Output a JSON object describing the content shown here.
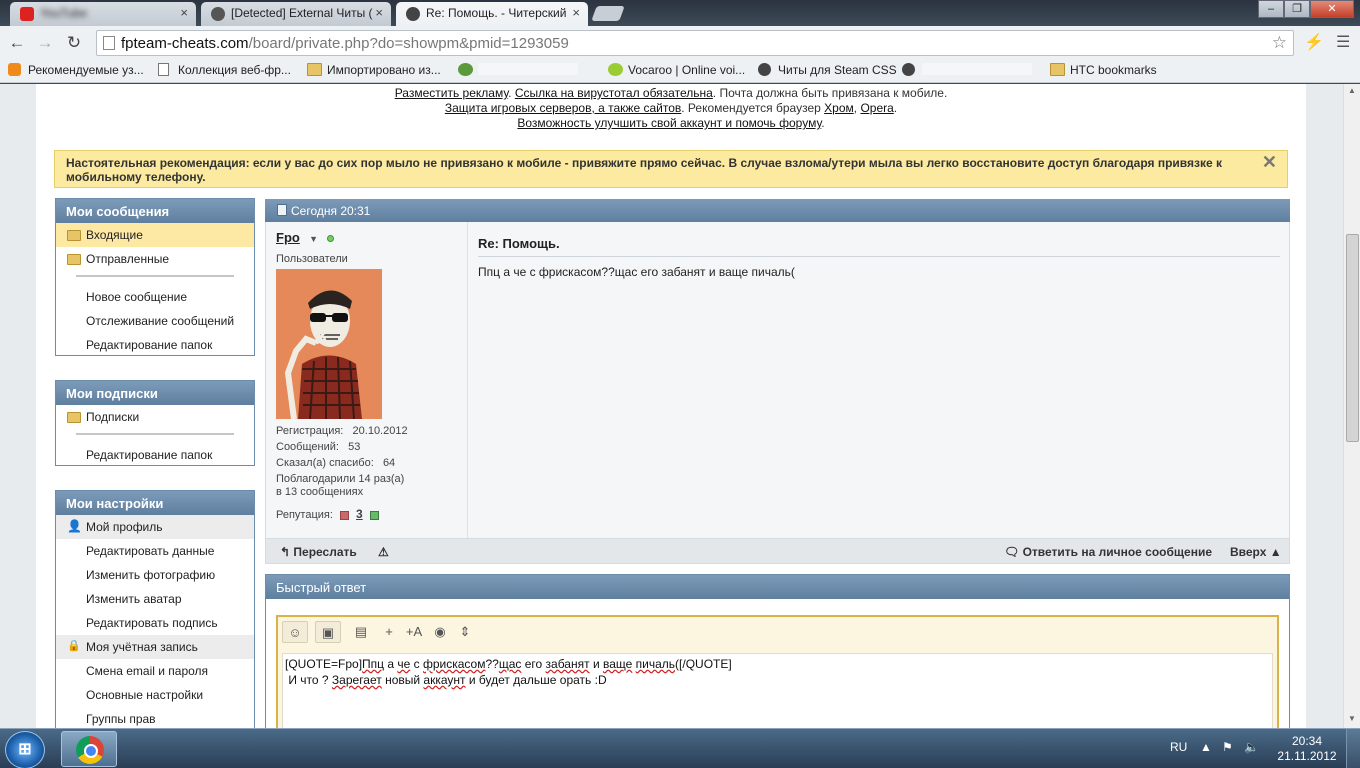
{
  "browser": {
    "tabs": [
      {
        "label": "YouTube",
        "close": "×"
      },
      {
        "label": "[Detected] External Читы (",
        "close": "×"
      },
      {
        "label": "Re: Помощь. - Читерский",
        "close": "×"
      }
    ],
    "url_host": "fpteam-cheats.com",
    "url_path": "/board/private.php?do=showpm&pmid=1293059",
    "bookmarks": [
      "Рекомендуемые уз...",
      "Коллекция веб-фр...",
      "Импортировано из...",
      "Vocaroo | Online voi...",
      "Читы для Steam CSS",
      "HTC bookmarks"
    ]
  },
  "notice": {
    "line1_link1": "Разместить рекламу",
    "line1_sep": ". ",
    "line1_link2": "Ссылка на вирустотал обязательна",
    "line1_text": ". Почта должна быть привязана к мобиле.",
    "line2_link": "Защита игровых серверов, а также сайтов",
    "line2_text": ". Рекомендуется браузер ",
    "line2_link2": "Хром",
    "line2_comma": ", ",
    "line2_link3": "Opera",
    "line2_dot": ".",
    "line3_link": "Возможность улучшить свой аккаунт и помочь форуму",
    "line3_dot": "."
  },
  "warning": {
    "text": "Настоятельная рекомендация: если у вас до сих пор мыло не привязано к мобиле - привяжите прямо сейчас. В случае взлома/утери мыла вы легко восстановите доступ благодаря привязке к мобильному телефону.",
    "close": "✕"
  },
  "sidebar": {
    "messages": {
      "title": "Мои сообщения",
      "inbox": "Входящие",
      "sent": "Отправленные",
      "new": "Новое сообщение",
      "tracking": "Отслеживание сообщений",
      "edit_folders": "Редактирование папок"
    },
    "subscriptions": {
      "title": "Мои подписки",
      "subs": "Подписки",
      "edit_folders": "Редактирование папок"
    },
    "settings": {
      "title": "Мои настройки",
      "profile": "Мой профиль",
      "edit_data": "Редактировать данные",
      "change_photo": "Изменить фотографию",
      "change_avatar": "Изменить аватар",
      "edit_signature": "Редактировать подпись",
      "account": "Моя учётная запись",
      "change_email": "Смена email и пароля",
      "basic": "Основные настройки",
      "groups": "Группы прав"
    }
  },
  "message": {
    "date": "Сегодня 20:31",
    "username": "Fpo",
    "role": "Пользователи",
    "reg_label": "Регистрация:",
    "reg_value": "20.10.2012",
    "posts_label": "Сообщений:",
    "posts_value": "53",
    "thanks_label": "Сказал(а) спасибо:",
    "thanks_value": "64",
    "thanked_line1": "Поблагодарили 14 раз(а)",
    "thanked_line2": "в 13 сообщениях",
    "rep_label": "Репутация:",
    "rep_value": "3",
    "title": "Re: Помощь.",
    "text": "Ппц а че с фрискасом??щас его забанят и ваще пичаль(",
    "forward": "Переслать",
    "reply": "Ответить на личное сообщение",
    "top": "Вверх"
  },
  "quick_reply": {
    "title": "Быстрый ответ",
    "line1_prefix": "[QUOTE=Fpo]",
    "line1_w1": "Ппц",
    "line1_t1": " а ",
    "line1_w2": "че",
    "line1_t2": " с ",
    "line1_w3": "фрискасом",
    "line1_t3": "??",
    "line1_w4": "щас",
    "line1_t4": " его ",
    "line1_w5": "забанят",
    "line1_t5": " и ",
    "line1_w6": "ваще",
    "line1_t6": " ",
    "line1_w7": "пичаль",
    "line1_suffix": "([/QUOTE]",
    "line2_prefix": " И что ? ",
    "line2_w1": "Зарегает",
    "line2_t1": " новый ",
    "line2_w2": "аккаунт",
    "line2_t2": " и будет дальше орать :D"
  },
  "taskbar": {
    "lang": "RU",
    "time": "20:34",
    "date": "21.11.2012"
  }
}
